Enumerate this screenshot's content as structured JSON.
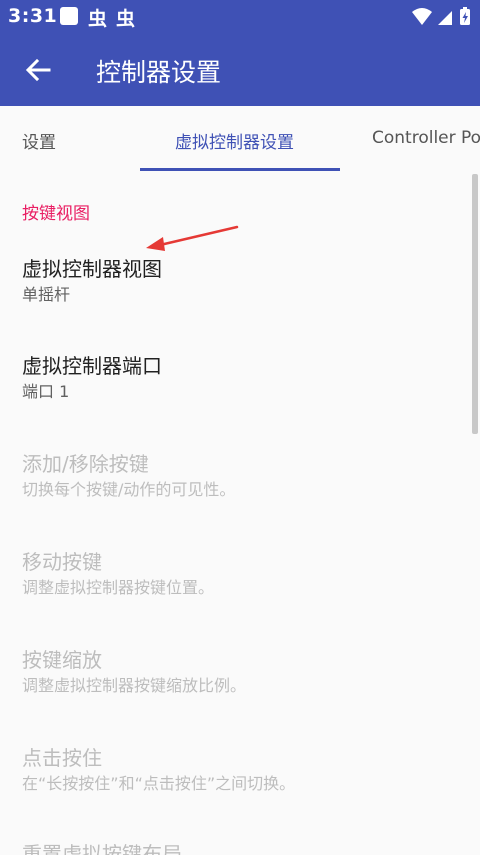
{
  "status_bar": {
    "time": "3:31",
    "notif_1": "虫",
    "notif_2": "虫",
    "icons": [
      "wifi-icon",
      "signal-icon",
      "battery-icon"
    ]
  },
  "app_bar": {
    "title": "控制器设置",
    "back_icon": "arrow-left-icon"
  },
  "tabs": [
    {
      "label": "设置"
    },
    {
      "label": "虚拟控制器设置",
      "active": true
    },
    {
      "label": "Controller Po"
    }
  ],
  "section": {
    "header": "按键视图"
  },
  "preferences": [
    {
      "title": "虚拟控制器视图",
      "summary": "单摇杆",
      "enabled": true
    },
    {
      "title": "虚拟控制器端口",
      "summary": "端口 1",
      "enabled": true
    },
    {
      "title": "添加/移除按键",
      "summary": "切换每个按键/动作的可见性。",
      "enabled": false
    },
    {
      "title": "移动按键",
      "summary": "调整虚拟控制器按键位置。",
      "enabled": false
    },
    {
      "title": "按键缩放",
      "summary": "调整虚拟控制器按键缩放比例。",
      "enabled": false
    },
    {
      "title": "点击按住",
      "summary": "在“长按按住”和“点击按住”之间切换。",
      "enabled": false
    },
    {
      "title": "重置虚拟按键布局",
      "summary": "",
      "enabled": false
    }
  ],
  "colors": {
    "primary": "#3f51b5",
    "accent": "#e91e63",
    "annotation": "#e53935"
  }
}
